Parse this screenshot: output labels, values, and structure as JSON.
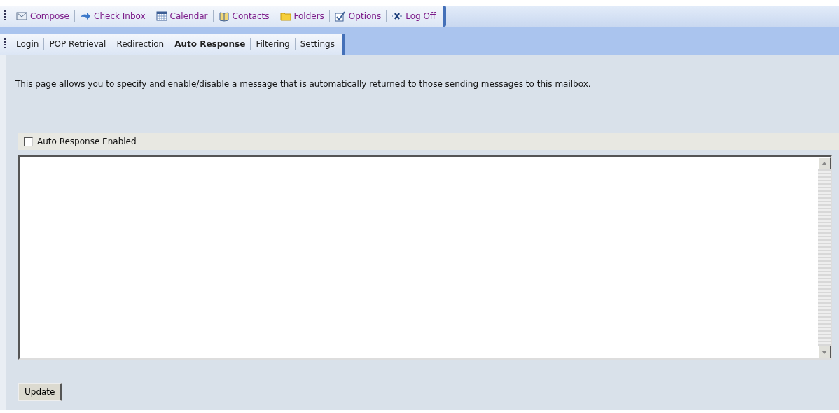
{
  "main_toolbar": [
    "Compose",
    "Check Inbox",
    "Calendar",
    "Contacts",
    "Folders",
    "Options",
    "Log Off"
  ],
  "tabs": [
    {
      "label": "Login",
      "selected": false
    },
    {
      "label": "POP Retrieval",
      "selected": false
    },
    {
      "label": "Redirection",
      "selected": false
    },
    {
      "label": "Auto Response",
      "selected": true
    },
    {
      "label": "Filtering",
      "selected": false
    },
    {
      "label": "Settings",
      "selected": false
    }
  ],
  "description": "This page allows you to specify and enable/disable a message that is automatically returned to those sending messages to this mailbox.",
  "auto_response": {
    "label": "Auto Response Enabled",
    "checked": false
  },
  "update_button": "Update"
}
